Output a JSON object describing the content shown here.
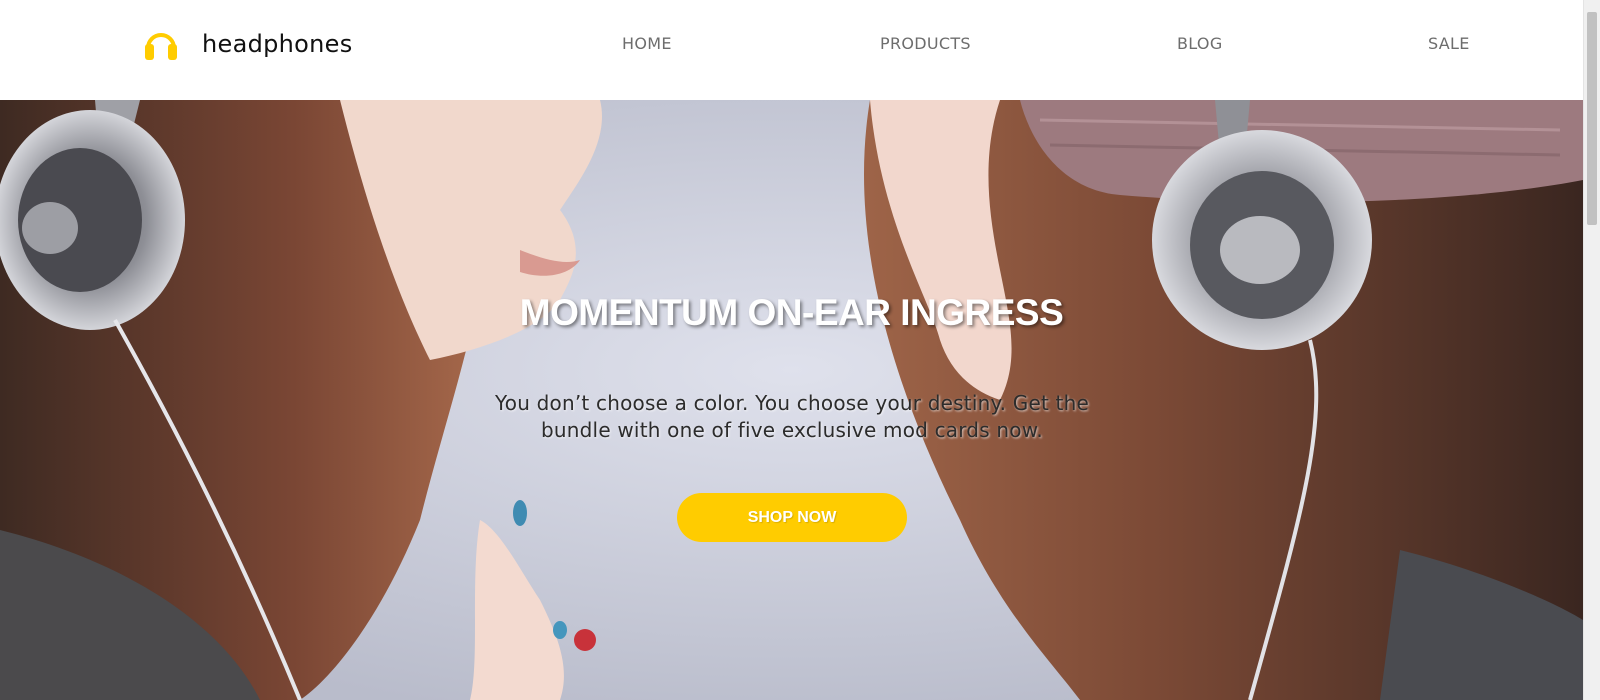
{
  "brand": {
    "name": "headphones",
    "accent_color": "#ffcc00",
    "icon": "headphones-icon"
  },
  "nav": {
    "items": [
      {
        "label": "HOME"
      },
      {
        "label": "PRODUCTS"
      },
      {
        "label": "BLOG"
      },
      {
        "label": "SALE"
      }
    ]
  },
  "hero": {
    "title": "MOMENTUM ON-EAR INGRESS",
    "subtitle": "You don’t choose a color. You choose your destiny. Get the bundle with one of five exclusive mod cards now.",
    "cta_label": "SHOP NOW",
    "cta_color": "#ffcc00"
  }
}
